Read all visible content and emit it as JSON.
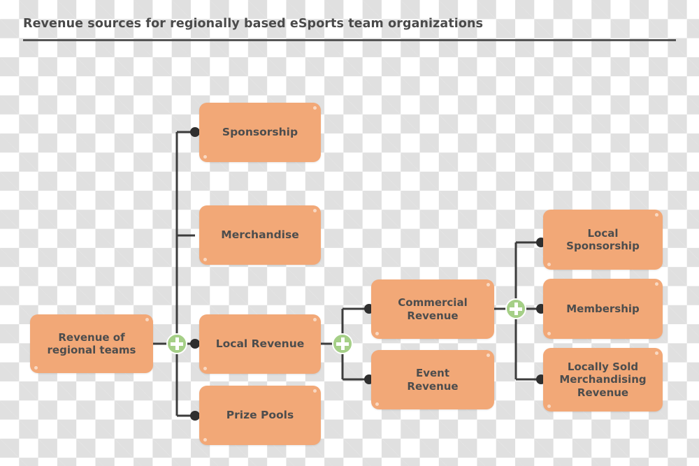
{
  "header": {
    "title": "Revenue sources for regionally based eSports team organizations"
  },
  "theme": {
    "node_fill": "#f2a877",
    "node_text": "#4d4d4d",
    "connector": "#3c3c3c",
    "plus_fill": "#a5cf87",
    "plus_glyph": "#ffffff",
    "title_text": "#4a4a4a",
    "title_rule": "#555555",
    "checker_light": "#ffffff",
    "checker_dark": "#e0e0e0"
  },
  "diagram": {
    "type": "tree",
    "orientation": "left-to-right",
    "root": {
      "id": "revenue-of-regional-teams",
      "label": "Revenue of\nregional teams",
      "line1": "Revenue of",
      "line2": "regional teams"
    },
    "junctions": [
      {
        "id": "junction-root",
        "name": "expand-collapse-plus",
        "state": "collapsed-toggle"
      },
      {
        "id": "junction-local-revenue",
        "name": "expand-collapse-plus",
        "state": "collapsed-toggle"
      },
      {
        "id": "junction-commercial-revenue",
        "name": "expand-collapse-plus",
        "state": "collapsed-toggle"
      }
    ],
    "level1": [
      {
        "id": "sponsorship",
        "label": "Sponsorship"
      },
      {
        "id": "merchandise",
        "label": "Merchandise"
      },
      {
        "id": "local-revenue",
        "label": "Local Revenue"
      },
      {
        "id": "prize-pools",
        "label": "Prize Pools"
      }
    ],
    "level2": [
      {
        "id": "commercial-revenue",
        "line1": "Commercial",
        "line2": "Revenue"
      },
      {
        "id": "event-revenue",
        "line1": "Event",
        "line2": "Revenue"
      }
    ],
    "level3": [
      {
        "id": "local-sponsorship",
        "line1": "Local",
        "line2": "Sponsorship",
        "line3": ""
      },
      {
        "id": "membership",
        "line1": "Membership",
        "line2": "",
        "line3": ""
      },
      {
        "id": "locally-sold-merchandising-revenue",
        "line1": "Locally Sold",
        "line2": "Merchandising",
        "line3": "Revenue"
      }
    ]
  }
}
